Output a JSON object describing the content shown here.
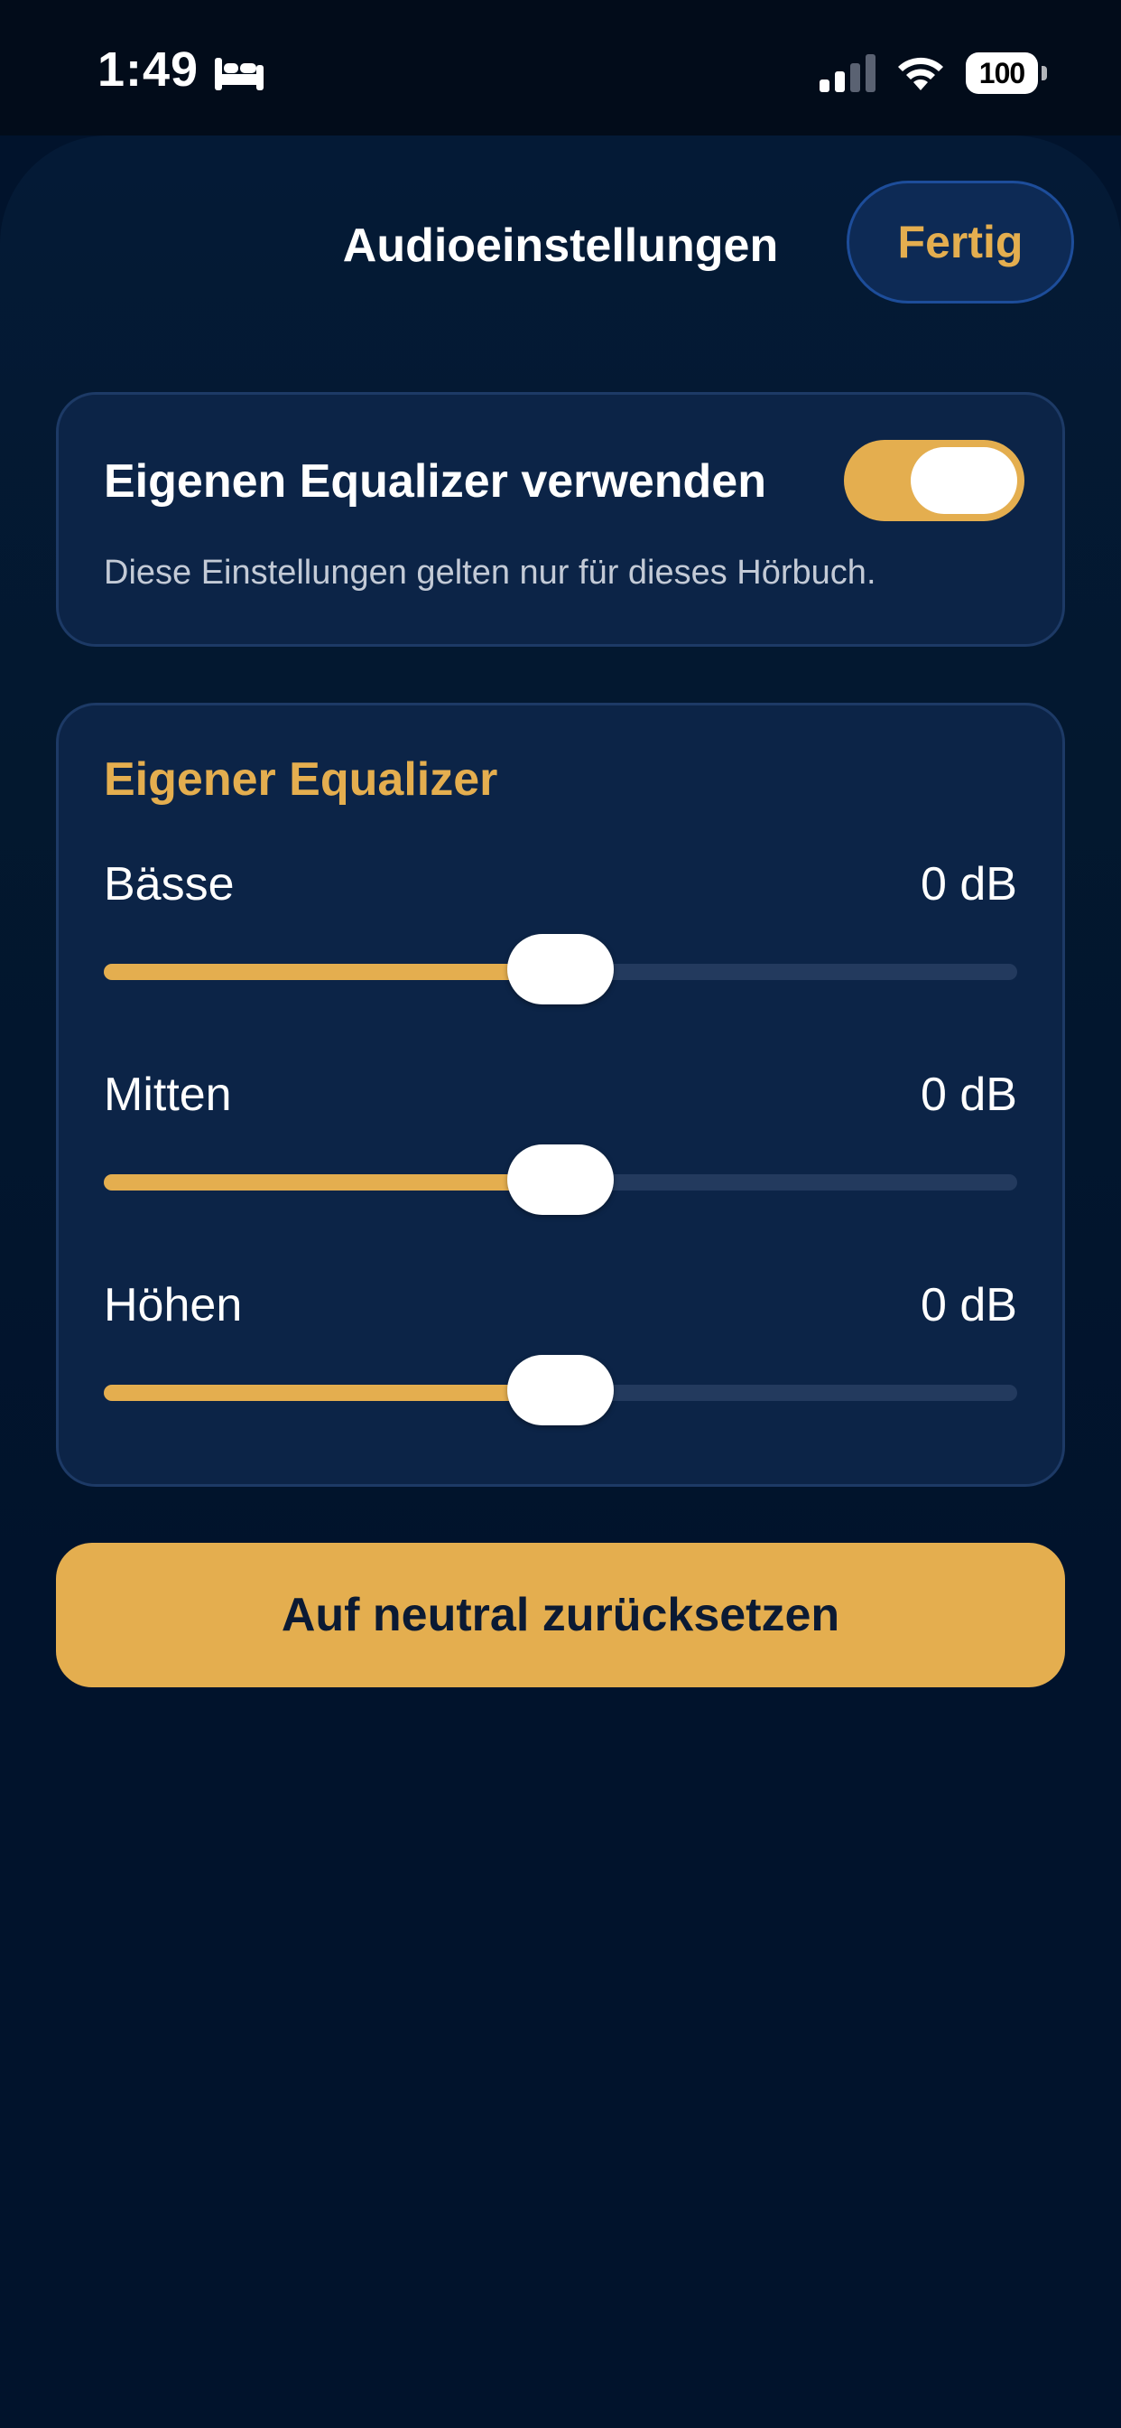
{
  "status_bar": {
    "time": "1:49",
    "battery": "100",
    "icons": [
      "bed-icon",
      "cellular-signal-icon",
      "wifi-icon",
      "battery-icon"
    ]
  },
  "header": {
    "title": "Audioeinstellungen",
    "done_label": "Fertig"
  },
  "custom_eq_card": {
    "toggle_label": "Eigenen Equalizer verwenden",
    "toggle_on": true,
    "hint": "Diese Einstellungen gelten nur für dieses Hörbuch."
  },
  "equalizer": {
    "title": "Eigener Equalizer",
    "bands": [
      {
        "label": "Bässe",
        "value": "0 dB",
        "level": 0.5
      },
      {
        "label": "Mitten",
        "value": "0 dB",
        "level": 0.5
      },
      {
        "label": "Höhen",
        "value": "0 dB",
        "level": 0.5
      }
    ]
  },
  "reset_label": "Auf neutral zurücksetzen",
  "colors": {
    "accent": "#e4ae4f",
    "background": "#01132c",
    "card": "#0c2447"
  }
}
